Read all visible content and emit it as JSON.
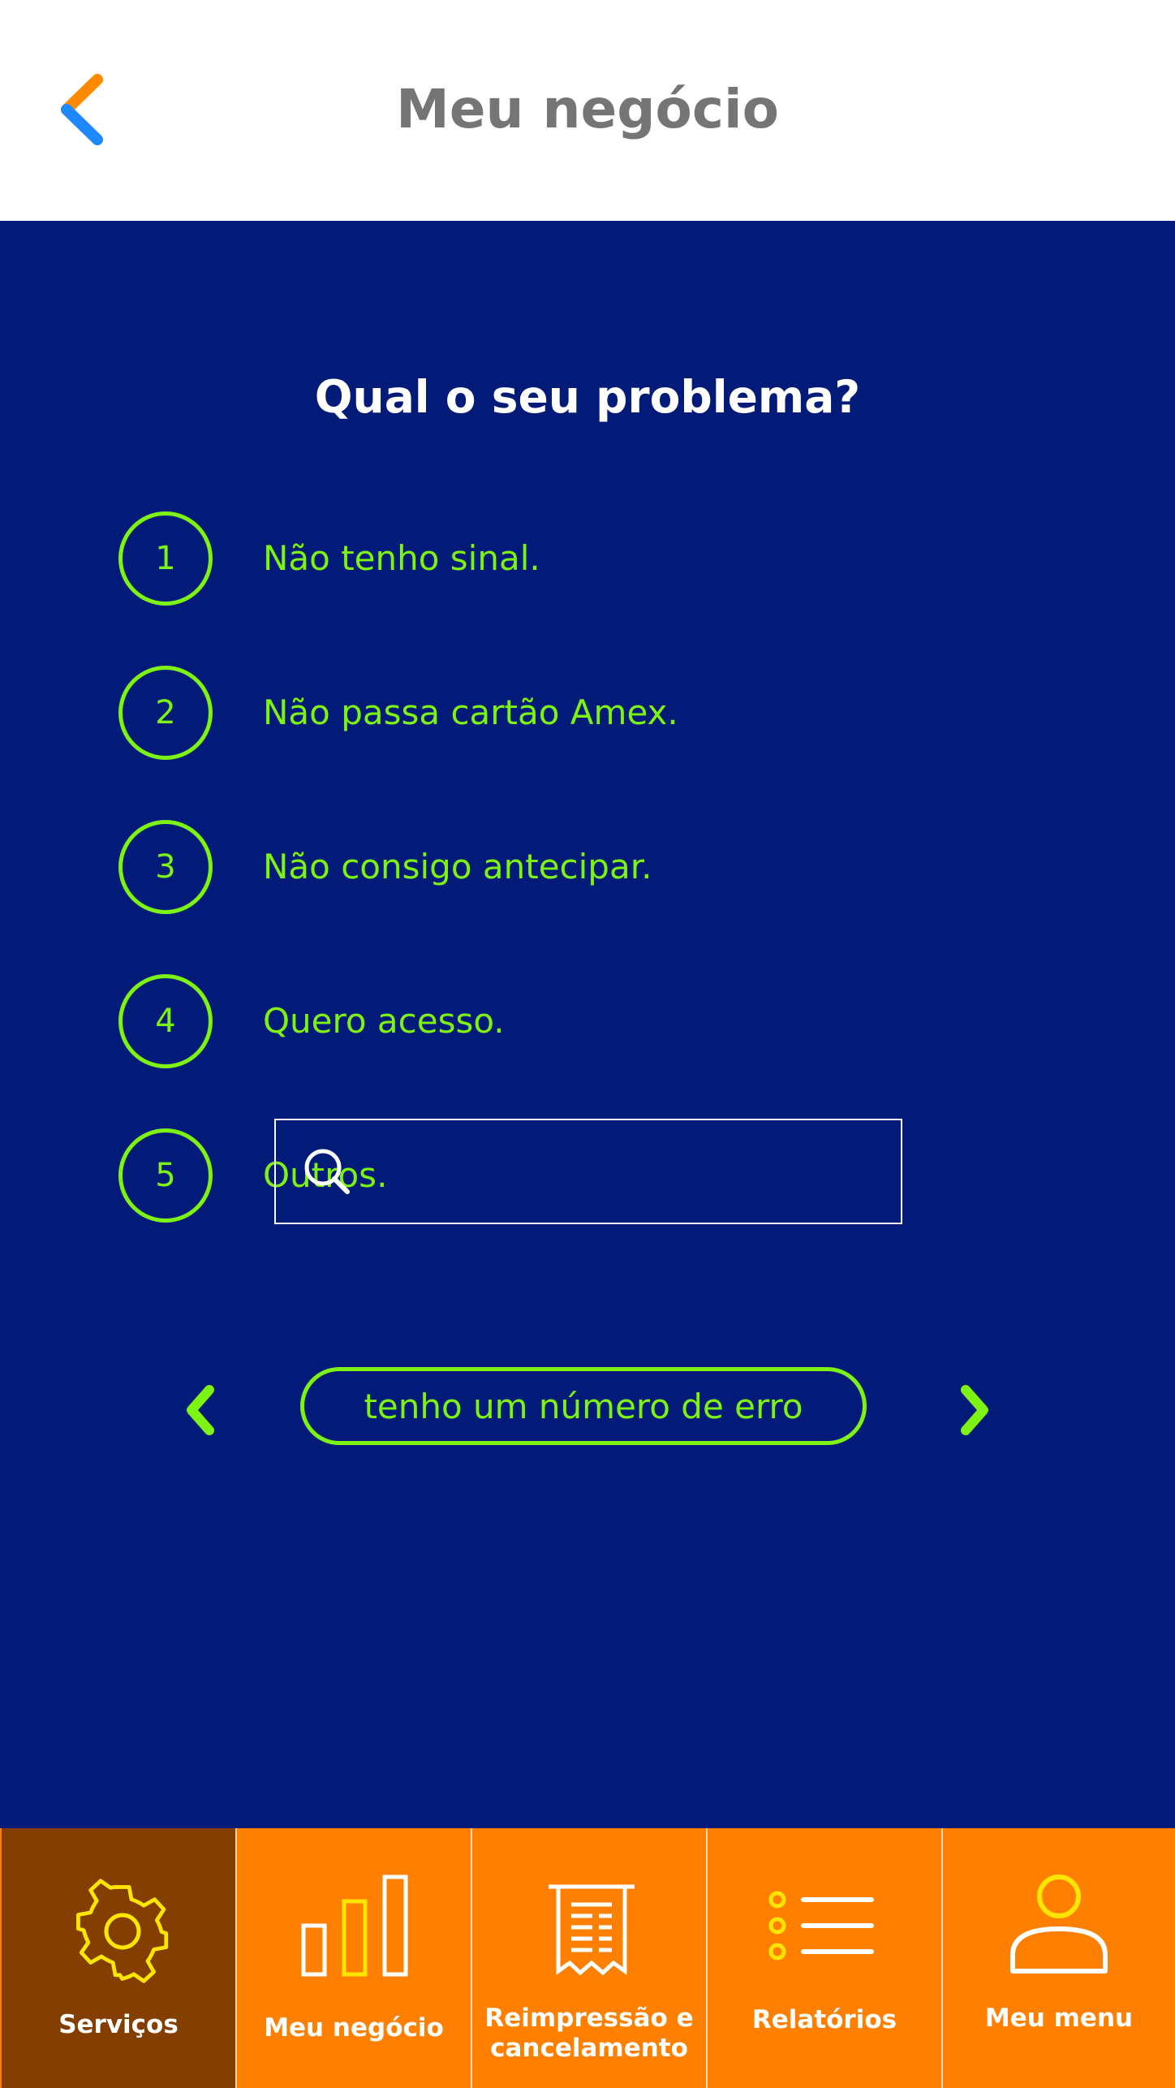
{
  "header": {
    "title": "Meu negócio",
    "back_icon": "back-chevron-icon"
  },
  "main": {
    "question": "Qual o seu problema?",
    "options": [
      {
        "number": "1",
        "label": "Não tenho sinal."
      },
      {
        "number": "2",
        "label": "Não passa cartão Amex."
      },
      {
        "number": "3",
        "label": "Não consigo antecipar."
      },
      {
        "number": "4",
        "label": "Quero acesso."
      },
      {
        "number": "5",
        "label": "Outros."
      }
    ],
    "search": {
      "value": "",
      "placeholder": "",
      "icon": "search-icon"
    },
    "error_button_label": "tenho um número de erro"
  },
  "tabbar": {
    "tabs": [
      {
        "label": "Serviços",
        "icon": "gear-icon",
        "active": true
      },
      {
        "label": "Meu negócio",
        "icon": "bar-chart-icon",
        "active": false
      },
      {
        "label": "Reimpressão e\ncancelamento",
        "icon": "receipt-icon",
        "active": false
      },
      {
        "label": "Relatórios",
        "icon": "list-icon",
        "active": false
      },
      {
        "label": "Meu menu",
        "icon": "user-icon",
        "active": false
      }
    ]
  },
  "colors": {
    "background": "#021b79",
    "accent_green": "#7cf313",
    "tabbar_orange": "#ff7f00",
    "tab_active": "#843f00",
    "icon_yellow": "#ffe600"
  }
}
